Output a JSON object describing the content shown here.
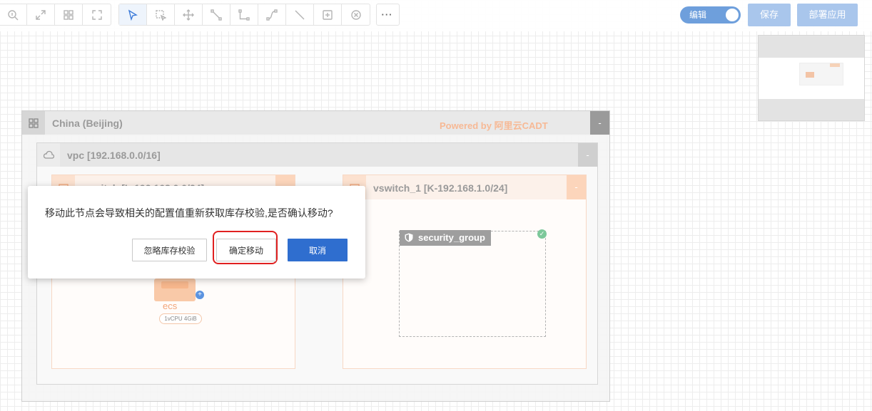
{
  "toolbar": {
    "zoom_tools": [
      "zoom-icon",
      "fit-icon",
      "grid-icon",
      "fullscreen-icon"
    ],
    "draw_tools": [
      "select-icon",
      "box-select-icon",
      "move-icon",
      "connector-icon",
      "elbow-connector-icon",
      "curve-connector-icon",
      "line-icon",
      "group-icon",
      "delete-icon"
    ],
    "more_label": "···",
    "edit_toggle_label": "编辑",
    "save_label": "保存",
    "deploy_label": "部署应用"
  },
  "colors": {
    "primary": "#2f6ecf",
    "disabled_primary": "#a9c6ec",
    "accent_orange": "#f7b995",
    "highlight_red": "#e02020"
  },
  "canvas": {
    "region": {
      "title": "China (Beijing)",
      "powered_by": "Powered by 阿里云CADT",
      "collapse": "-"
    },
    "vpc": {
      "title": "vpc [192.168.0.0/16]",
      "collapse": "-"
    },
    "vswitches": [
      {
        "title": "vswitch [L-192.168.0.0/24]",
        "collapse": "-"
      },
      {
        "title": "vswitch_1 [K-192.168.1.0/24]",
        "collapse": "-"
      }
    ],
    "security_group": {
      "title": "security_group"
    },
    "ecs": {
      "name": "ecs",
      "spec": "1vCPU  4GiB",
      "add": "+"
    }
  },
  "modal": {
    "message": "移动此节点会导致相关的配置值重新获取库存校验,是否确认移动?",
    "ignore_label": "忽略库存校验",
    "confirm_label": "确定移动",
    "cancel_label": "取消"
  }
}
